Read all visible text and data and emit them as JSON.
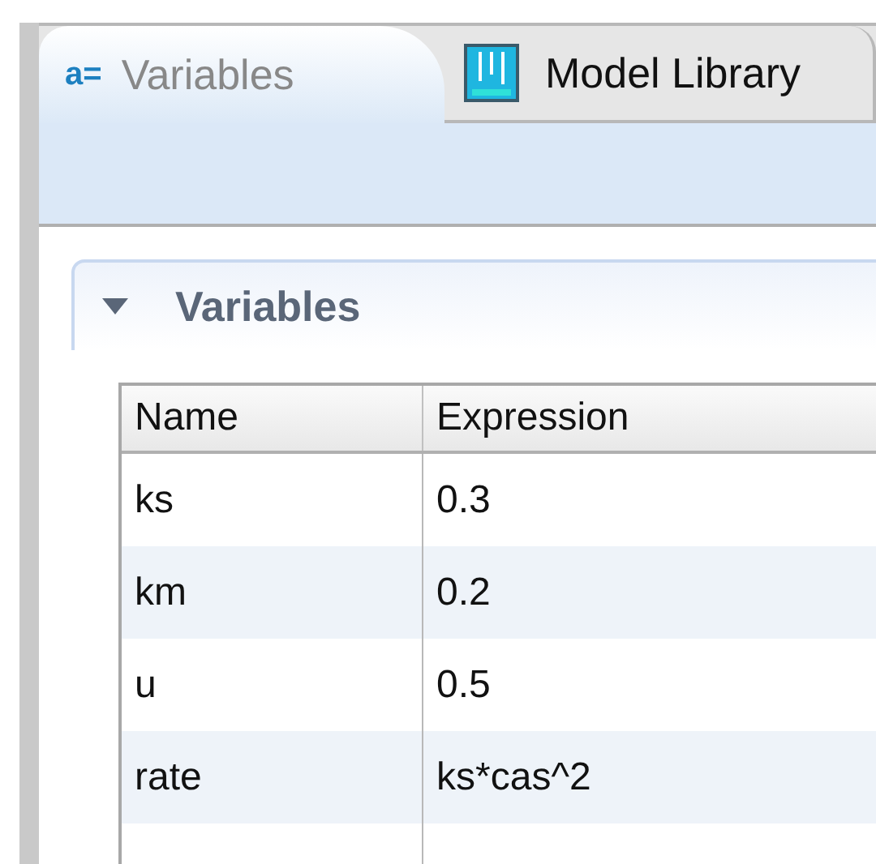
{
  "tabs": [
    {
      "label": "Variables",
      "icon_text": "a=",
      "selected": true
    },
    {
      "label": "Model Library",
      "selected": false
    }
  ],
  "section": {
    "title": "Variables",
    "expanded": true,
    "table": {
      "columns": [
        "Name",
        "Expression"
      ],
      "rows": [
        {
          "name": "ks",
          "expression": "0.3"
        },
        {
          "name": "km",
          "expression": "0.2"
        },
        {
          "name": "u",
          "expression": "0.5"
        },
        {
          "name": "rate",
          "expression": "ks*cas^2"
        }
      ]
    }
  }
}
